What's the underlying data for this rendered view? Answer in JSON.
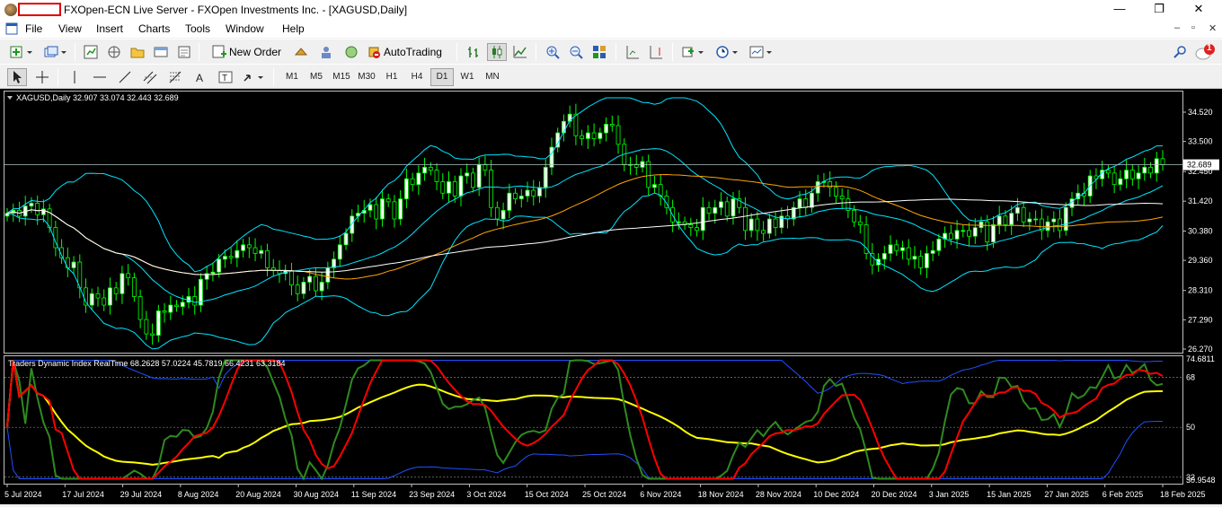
{
  "window": {
    "title": "FXOpen-ECN Live Server - FXOpen Investments Inc. - [XAGUSD,Daily]",
    "controls": {
      "minimize": "—",
      "maximize": "❐",
      "close": "✕"
    }
  },
  "menu": {
    "items": [
      "File",
      "View",
      "Insert",
      "Charts",
      "Tools",
      "Window",
      "Help"
    ],
    "mdi": {
      "minimize": "–",
      "restore": "▫",
      "close": "✕"
    }
  },
  "toolbar": {
    "new_order_label": "New Order",
    "autotrading_label": "AutoTrading",
    "notification_count": "1",
    "timeframes": [
      "M1",
      "M5",
      "M15",
      "M30",
      "H1",
      "H4",
      "D1",
      "W1",
      "MN"
    ],
    "active_timeframe": "D1"
  },
  "chart": {
    "header": "XAGUSD,Daily  32.907 33.074 32.443 32.689",
    "current_price": "32.689",
    "price_axis": [
      "34.520",
      "33.500",
      "32.450",
      "31.420",
      "30.380",
      "29.360",
      "28.310",
      "27.290",
      "26.270"
    ],
    "price_range": [
      26.27,
      34.52
    ],
    "date_axis": [
      "5 Jul 2024",
      "17 Jul 2024",
      "29 Jul 2024",
      "8 Aug 2024",
      "20 Aug 2024",
      "30 Aug 2024",
      "11 Sep 2024",
      "23 Sep 2024",
      "3 Oct 2024",
      "15 Oct 2024",
      "25 Oct 2024",
      "6 Nov 2024",
      "18 Nov 2024",
      "28 Nov 2024",
      "10 Dec 2024",
      "20 Dec 2024",
      "3 Jan 2025",
      "15 Jan 2025",
      "27 Jan 2025",
      "6 Feb 2025",
      "18 Feb 2025"
    ],
    "closes": [
      31.0,
      31.1,
      30.9,
      31.25,
      31.35,
      30.95,
      31.15,
      30.5,
      29.8,
      29.45,
      29.1,
      29.3,
      28.4,
      27.8,
      28.2,
      28.05,
      27.8,
      28.4,
      28.2,
      28.9,
      28.75,
      28.1,
      27.3,
      26.8,
      26.75,
      27.6,
      27.55,
      27.8,
      27.75,
      27.9,
      28.1,
      27.8,
      28.7,
      28.9,
      28.95,
      29.4,
      29.5,
      29.45,
      29.7,
      29.9,
      29.8,
      29.6,
      29.7,
      29.1,
      29.0,
      28.9,
      29.0,
      28.5,
      28.2,
      28.6,
      28.8,
      28.3,
      28.6,
      29.1,
      29.4,
      29.9,
      30.3,
      30.9,
      31.0,
      31.1,
      31.3,
      30.8,
      31.5,
      31.4,
      30.8,
      31.5,
      32.2,
      32.0,
      32.4,
      32.6,
      32.5,
      32.1,
      31.7,
      32.1,
      31.6,
      32.3,
      32.4,
      31.9,
      32.7,
      32.5,
      31.2,
      30.8,
      31.1,
      31.7,
      31.5,
      31.6,
      31.8,
      31.6,
      31.9,
      32.6,
      33.3,
      33.8,
      34.2,
      34.45,
      33.7,
      33.6,
      33.8,
      33.6,
      33.8,
      34.1,
      34.05,
      33.4,
      32.7,
      32.7,
      32.6,
      32.8,
      31.9,
      32.0,
      31.6,
      31.2,
      30.7,
      30.7,
      30.6,
      30.5,
      30.4,
      31.2,
      31.0,
      31.2,
      31.4,
      30.9,
      31.5,
      31.2,
      30.4,
      30.8,
      30.4,
      30.3,
      30.8,
      30.5,
      30.9,
      30.8,
      31.2,
      31.5,
      31.2,
      31.7,
      32.1,
      32.1,
      31.9,
      31.6,
      31.5,
      31.1,
      30.7,
      30.6,
      29.6,
      29.2,
      29.4,
      29.6,
      29.9,
      29.7,
      29.8,
      29.4,
      29.5,
      29.1,
      29.6,
      29.7,
      30.1,
      30.3,
      30.1,
      30.4,
      30.4,
      30.2,
      30.5,
      30.7,
      30.0,
      30.6,
      30.9,
      30.6,
      31.0,
      31.2,
      30.7,
      30.8,
      30.8,
      30.4,
      30.7,
      30.8,
      30.4,
      31.2,
      31.5,
      31.7,
      31.6,
      32.3,
      32.2,
      32.5,
      32.4,
      32.0,
      32.2,
      32.5,
      32.2,
      32.4,
      32.6,
      32.4,
      32.9,
      32.69
    ],
    "indicator": {
      "header": "Traders Dynamic Index RealTime 68.2628 57.0224 45.7819 66.4231 63.3184",
      "axis": [
        "74.6811",
        "68",
        "50",
        "32",
        "30.9548"
      ],
      "range": [
        30.9548,
        74.6811
      ]
    }
  },
  "colors": {
    "bg": "#000000",
    "bull_candle": "#ffffff",
    "bear_candle": "#000000",
    "candle_outline": "#00ff00",
    "bollinger": "#00e5ff",
    "ma_white": "#ffffff",
    "ma_orange": "#ffa500",
    "tdi_green": "#2e8b1e",
    "tdi_red": "#ff0000",
    "tdi_yellow": "#ffff00",
    "tdi_blue": "#1e50ff"
  }
}
